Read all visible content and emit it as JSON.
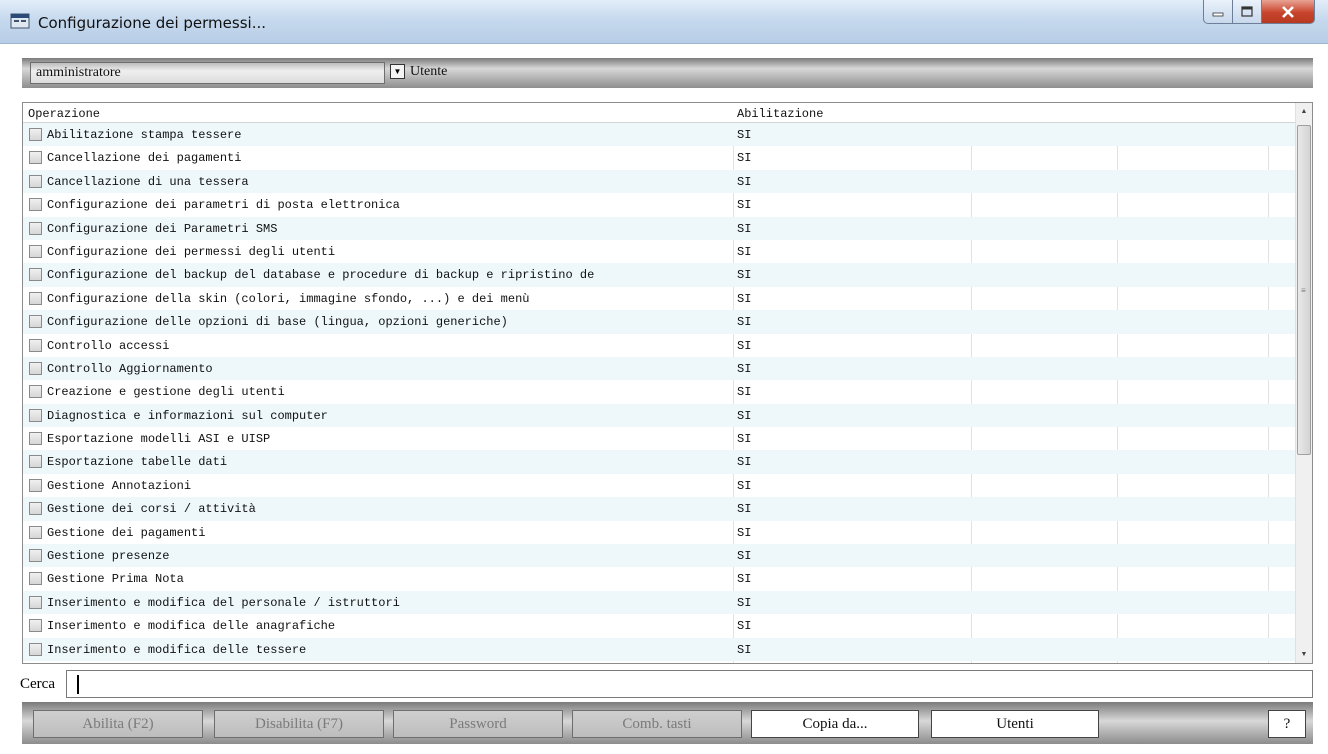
{
  "window": {
    "title": "Configurazione dei permessi..."
  },
  "toolbar": {
    "selected_user": "amministratore",
    "user_label": "Utente"
  },
  "grid": {
    "headers": {
      "operation": "Operazione",
      "enabled": "Abilitazione"
    },
    "rows": [
      {
        "op": "Abilitazione stampa tessere",
        "ab": "SI"
      },
      {
        "op": "Cancellazione dei pagamenti",
        "ab": "SI"
      },
      {
        "op": "Cancellazione di una tessera",
        "ab": "SI"
      },
      {
        "op": "Configurazione dei parametri di posta elettronica",
        "ab": "SI"
      },
      {
        "op": "Configurazione dei Parametri SMS",
        "ab": "SI"
      },
      {
        "op": "Configurazione dei permessi degli utenti",
        "ab": "SI"
      },
      {
        "op": "Configurazione del backup del database e procedure di backup e ripristino de",
        "ab": "SI"
      },
      {
        "op": "Configurazione della skin (colori, immagine sfondo, ...) e dei menù",
        "ab": "SI"
      },
      {
        "op": "Configurazione delle opzioni di base (lingua, opzioni generiche)",
        "ab": "SI"
      },
      {
        "op": "Controllo accessi",
        "ab": "SI"
      },
      {
        "op": "Controllo Aggiornamento",
        "ab": "SI"
      },
      {
        "op": "Creazione e gestione degli utenti",
        "ab": "SI"
      },
      {
        "op": "Diagnostica e informazioni sul computer",
        "ab": "SI"
      },
      {
        "op": "Esportazione modelli ASI e UISP",
        "ab": "SI"
      },
      {
        "op": "Esportazione tabelle dati",
        "ab": "SI"
      },
      {
        "op": "Gestione Annotazioni",
        "ab": "SI"
      },
      {
        "op": "Gestione dei corsi / attività",
        "ab": "SI"
      },
      {
        "op": "Gestione dei pagamenti",
        "ab": "SI"
      },
      {
        "op": "Gestione presenze",
        "ab": "SI"
      },
      {
        "op": "Gestione Prima Nota",
        "ab": "SI"
      },
      {
        "op": "Inserimento e modifica del personale / istruttori",
        "ab": "SI"
      },
      {
        "op": "Inserimento e modifica delle anagrafiche",
        "ab": "SI"
      },
      {
        "op": "Inserimento e modifica delle tessere",
        "ab": "SI"
      }
    ]
  },
  "search": {
    "label": "Cerca",
    "value": ""
  },
  "buttons": {
    "enable": "Abilita  (F2)",
    "disable": "Disabilita (F7)",
    "password": "Password",
    "shortcuts": "Comb. tasti",
    "copy_from": "Copia da...",
    "users": "Utenti",
    "help": "?"
  }
}
